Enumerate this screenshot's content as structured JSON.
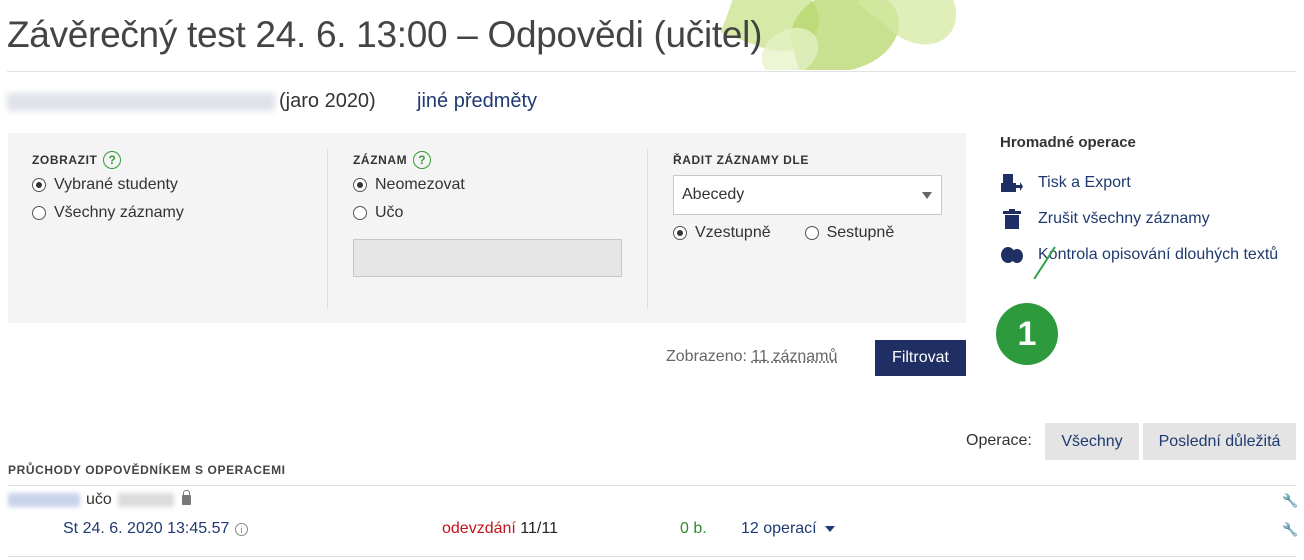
{
  "page": {
    "title": "Závěrečný test 24. 6. 13:00 – Odpovědi (učitel)",
    "subject_period": "(jaro 2020)",
    "other_subjects_link": "jiné předměty"
  },
  "filters": {
    "show": {
      "header": "ZOBRAZIT",
      "options": [
        "Vybrané studenty",
        "Všechny záznamy"
      ],
      "selected": 0
    },
    "record": {
      "header": "ZÁZNAM",
      "options": [
        "Neomezovat",
        "Učo"
      ],
      "selected": 0,
      "uco_value": ""
    },
    "sort": {
      "header": "ŘADIT ZÁZNAMY DLE",
      "selected_option": "Abecedy",
      "directions": [
        "Vzestupně",
        "Sestupně"
      ],
      "selected_direction": 0
    },
    "help_glyph": "?",
    "displayed_prefix": "Zobrazeno: ",
    "displayed_count": "11 záznamů",
    "filter_button": "Filtrovat"
  },
  "bulk_operations": {
    "title": "Hromadné operace",
    "items": [
      {
        "label": "Tisk a Export",
        "icon": "print-export-icon"
      },
      {
        "label": "Zrušit všechny záznamy",
        "icon": "trash-icon"
      },
      {
        "label": "Kontrola opisování dlouhých textů",
        "icon": "plagiarism-check-icon"
      }
    ]
  },
  "callout": {
    "number": "1",
    "color": "#2e9a3e"
  },
  "operations_bar": {
    "label": "Operace:",
    "buttons": [
      "Všechny",
      "Poslední důležitá"
    ]
  },
  "list": {
    "header": "PRŮCHODY ODPOVĚDNÍKEM S OPERACEMI",
    "rows": [
      {
        "uco_label": "učo",
        "date": "St 24. 6. 2020 13:45.57",
        "status_word": "odevzdání",
        "status_count": "11/11",
        "points": "0 b.",
        "operations": "12 operací"
      }
    ]
  },
  "colors": {
    "accent": "#1f2e63",
    "link": "#1f3a70",
    "status_red": "#c0141c",
    "points_green": "#2e8a2e"
  }
}
